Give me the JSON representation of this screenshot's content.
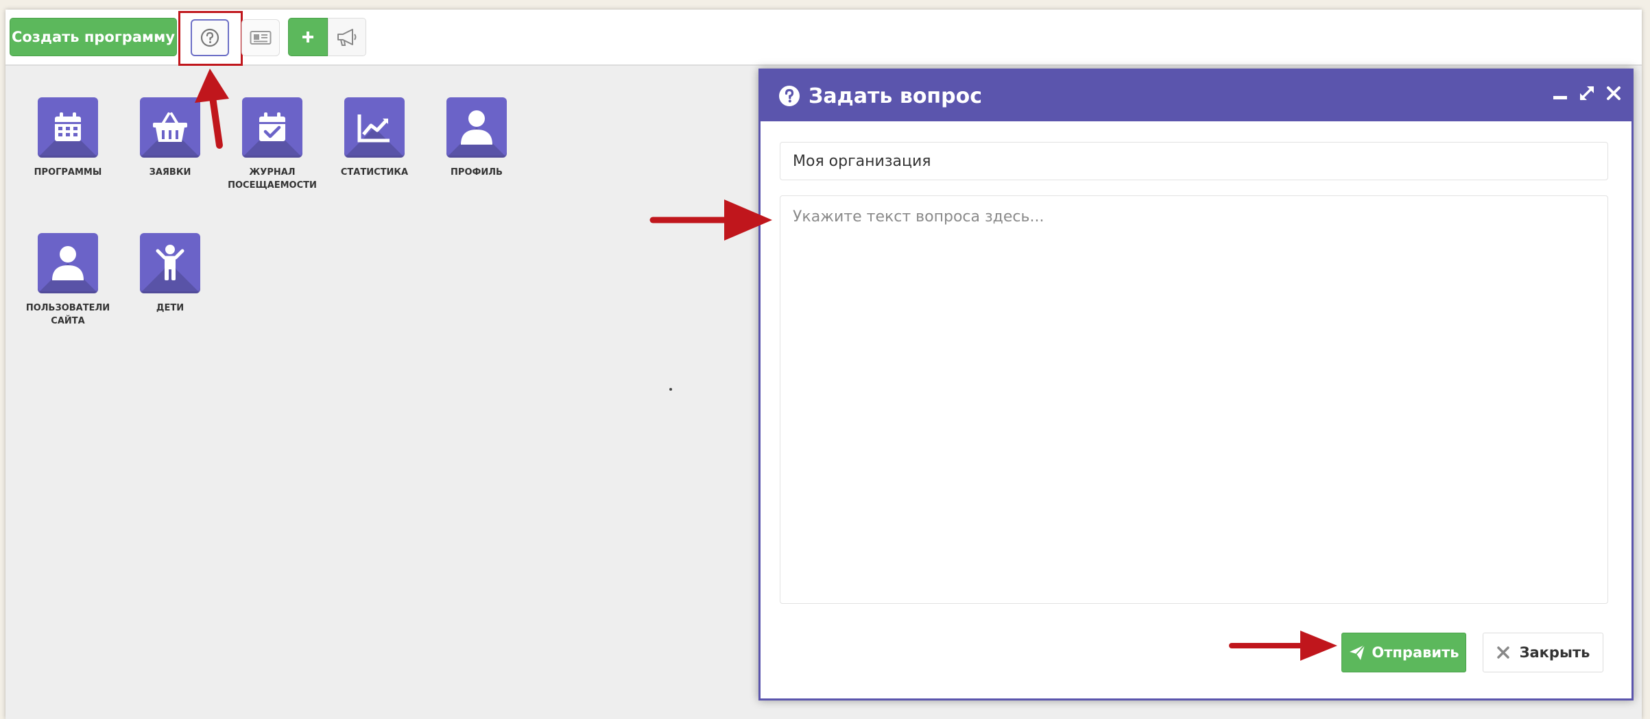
{
  "toolbar": {
    "create_program_label": "Создать программу",
    "help_icon": "question-circle-icon",
    "news_icon": "newspaper-icon",
    "plus_icon": "plus-icon",
    "megaphone_icon": "megaphone-icon"
  },
  "tiles": [
    {
      "label": "ПРОГРАММЫ",
      "icon": "calendar-icon"
    },
    {
      "label": "ЗАЯВКИ",
      "icon": "basket-icon"
    },
    {
      "label": "ЖУРНАЛ ПОСЕЩАЕМОСТИ",
      "icon": "calendar-check-icon"
    },
    {
      "label": "СТАТИСТИКА",
      "icon": "chart-line-icon"
    },
    {
      "label": "ПРОФИЛЬ",
      "icon": "user-icon"
    },
    {
      "label": "ПОЛЬЗОВАТЕЛИ САЙТА",
      "icon": "user-icon"
    },
    {
      "label": "ДЕТИ",
      "icon": "child-icon"
    }
  ],
  "dialog": {
    "title": "Задать вопрос",
    "organization_value": "Моя организация",
    "question_placeholder": "Укажите текст вопроса здесь...",
    "send_label": "Отправить",
    "close_label": "Закрыть"
  },
  "colors": {
    "accent_purple": "#5b55ad",
    "tile_purple": "#6b63c8",
    "green": "#5cb85c",
    "annotation_red": "#c0161c"
  }
}
